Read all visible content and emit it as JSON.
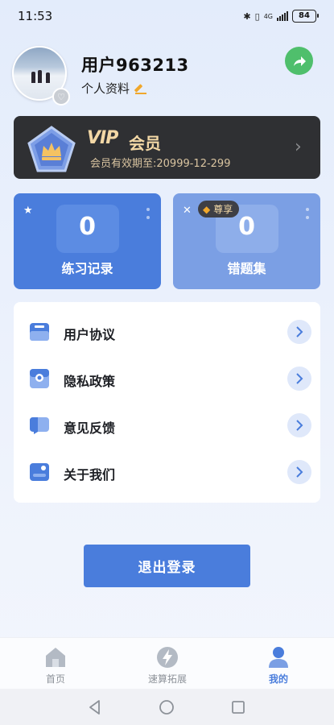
{
  "status_bar": {
    "time": "11:53",
    "network": "4G",
    "battery": "84"
  },
  "profile": {
    "username": "用户963213",
    "profile_link": "个人资料"
  },
  "vip": {
    "logo": "VIP",
    "label": "会员",
    "expiry": "会员有效期至:20999-12-299"
  },
  "stats": {
    "practice": {
      "value": "0",
      "label": "练习记录"
    },
    "wrong": {
      "value": "0",
      "label": "错题集",
      "badge": "尊享"
    }
  },
  "menu": {
    "items": [
      {
        "label": "用户协议",
        "icon": "agreement-icon"
      },
      {
        "label": "隐私政策",
        "icon": "privacy-icon"
      },
      {
        "label": "意见反馈",
        "icon": "feedback-icon"
      },
      {
        "label": "关于我们",
        "icon": "about-icon"
      }
    ]
  },
  "logout_label": "退出登录",
  "bottom_nav": {
    "tabs": [
      {
        "label": "首页",
        "icon": "home-icon",
        "active": false
      },
      {
        "label": "速算拓展",
        "icon": "lightning-icon",
        "active": false
      },
      {
        "label": "我的",
        "icon": "user-icon",
        "active": true
      }
    ]
  },
  "colors": {
    "primary": "#4a7ddc",
    "light_blue": "#7b9fe4",
    "vip_dark": "#2f3033",
    "vip_gold": "#f3d8a6",
    "share_green": "#4fbf6c"
  }
}
